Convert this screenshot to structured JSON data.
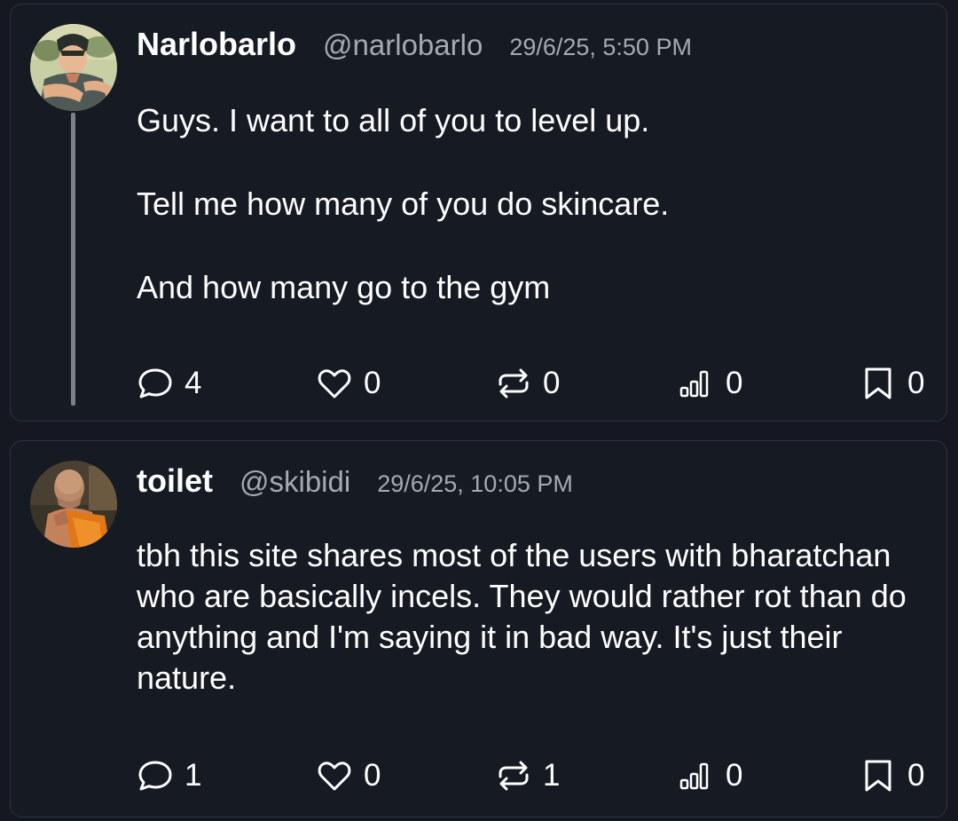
{
  "posts": [
    {
      "display_name": "Narlobarlo",
      "handle": "@narlobarlo",
      "timestamp": "29/6/25, 5:50 PM",
      "avatar_icon": "anime-character-avatar",
      "paragraphs": [
        "Guys.  I want to all of you to level up.",
        "Tell me how many of you do skincare.",
        "And how many go to the gym"
      ],
      "counts": {
        "replies": "4",
        "likes": "0",
        "reposts": "0",
        "views": "0",
        "bookmarks": "0"
      }
    },
    {
      "display_name": "toilet",
      "handle": "@skibidi",
      "timestamp": "29/6/25, 10:05 PM",
      "avatar_icon": "monk-photo-avatar",
      "paragraphs": [
        "tbh this site shares most of the users with bharatchan who are basically incels. They would rather rot than do anything and I'm saying it in bad way. It's just their nature."
      ],
      "counts": {
        "replies": "1",
        "likes": "0",
        "reposts": "1",
        "views": "0",
        "bookmarks": "0"
      }
    }
  ],
  "icons": {
    "reply": "speech-bubble-icon",
    "like": "heart-icon",
    "repost": "repost-arrows-icon",
    "views": "bar-chart-icon",
    "bookmark": "bookmark-icon"
  },
  "colors": {
    "background": "#151820",
    "card_border": "#2c3440",
    "text_primary": "#ffffff",
    "text_secondary": "#a5a9b0",
    "thread_line": "#7d8087"
  }
}
